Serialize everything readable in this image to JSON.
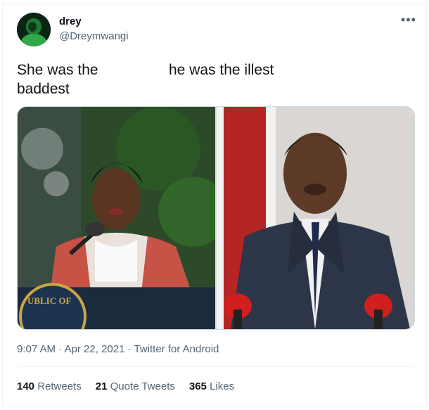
{
  "tweet": {
    "display_name": "drey",
    "handle": "@Dreymwangi",
    "text_left": "She was the baddest",
    "text_right": "he was the illest",
    "more_icon": "more-icon",
    "timestamp": "9:07 AM · Apr 22, 2021 · Twitter for Android",
    "retweets": "140",
    "retweets_label": "Retweets",
    "quote_tweets": "21",
    "quote_tweets_label": "Quote Tweets",
    "likes": "365",
    "likes_label": "Likes",
    "seal_text": "UBLIC OF"
  },
  "colors": {
    "text": "#0f1419",
    "secondary": "#536471",
    "border": "#eff3f4"
  }
}
